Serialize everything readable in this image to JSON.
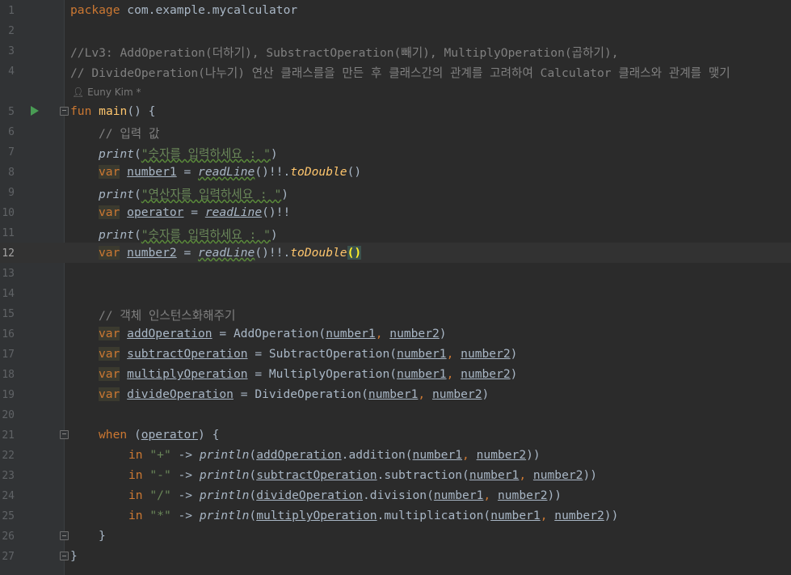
{
  "editor": {
    "line_numbers": [
      "1",
      "2",
      "3",
      "4",
      "5",
      "6",
      "7",
      "8",
      "9",
      "10",
      "11",
      "12",
      "13",
      "14",
      "15",
      "16",
      "17",
      "18",
      "19",
      "20",
      "21",
      "22",
      "23",
      "24",
      "25",
      "26",
      "27"
    ],
    "current_line": "12",
    "author_hint": "Euny Kim *"
  },
  "code": {
    "l1_kw": "package",
    "l1_pkg": " com.example.mycalculator",
    "l3": "//Lv3: AddOperation(더하기), SubstractOperation(빼기), MultiplyOperation(곱하기),",
    "l4": "// DivideOperation(나누기) 연산 클래스를을 만든 후 클래스간의 관계를 고려하여 Calculator 클래스와 관계를 맺기",
    "l5_kw": "fun",
    "l5_fn": "main",
    "l5_rest": "() {",
    "l6": "// 입력 값",
    "print": "print",
    "println": "println",
    "readLine": "readLine",
    "toDouble": "toDouble",
    "var": "var",
    "in": "in",
    "when": "when",
    "s_num": "\"숫자를 입력하세요 : \"",
    "s_op": "\"연산자를 입력하세요 : \"",
    "number1": "number1",
    "number2": "number2",
    "operator": "operator",
    "l15": "// 객체 인스턴스화해주기",
    "addOperation": "addOperation",
    "subtractOperation": "subtractOperation",
    "multiplyOperation": "multiplyOperation",
    "divideOperation": "divideOperation",
    "AddOperation": "AddOperation",
    "SubtractOperation": "SubtractOperation",
    "MultiplyOperation": "MultiplyOperation",
    "DivideOperation": "DivideOperation",
    "addition": "addition",
    "subtraction": "subtraction",
    "division": "division",
    "multiplication": "multiplication",
    "op_plus": "\"+\"",
    "op_minus": "\"-\"",
    "op_div": "\"/\"",
    "op_mul": "\"*\""
  }
}
